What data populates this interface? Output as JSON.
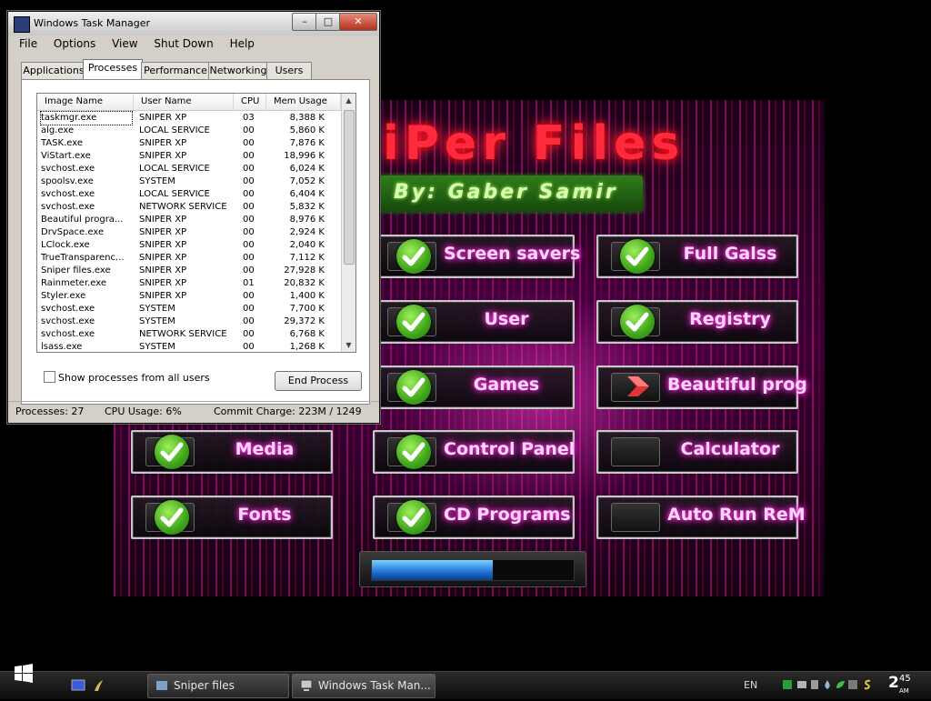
{
  "app": {
    "title": "iPer  Files",
    "byline": "By: Gaber  Samir",
    "buttons": [
      {
        "label": "Screen savers",
        "kind": "check"
      },
      {
        "label": "Full Galss",
        "kind": "check"
      },
      {
        "label": "User",
        "kind": "check"
      },
      {
        "label": "Registry",
        "kind": "check"
      },
      {
        "label": "Games",
        "kind": "check"
      },
      {
        "label": "Beautiful prog",
        "kind": "arrow"
      },
      {
        "label": "Media",
        "kind": "check"
      },
      {
        "label": "Control Panel",
        "kind": "check"
      },
      {
        "label": "Calculator",
        "kind": "empty"
      },
      {
        "label": "Fonts",
        "kind": "check"
      },
      {
        "label": "CD Programs",
        "kind": "check"
      },
      {
        "label": "Auto Run ReM",
        "kind": "empty"
      }
    ],
    "progress": 0.6,
    "colors": {
      "title": "#ff2a3c",
      "button_text": "#ffd6ff",
      "byline_bg": "#2f7d1a",
      "check": "#3fa51a"
    }
  },
  "task_manager": {
    "title": "Windows Task Manager",
    "menu": [
      "File",
      "Options",
      "View",
      "Shut Down",
      "Help"
    ],
    "tabs": [
      "Applications",
      "Processes",
      "Performance",
      "Networking",
      "Users"
    ],
    "active_tab": "Processes",
    "columns": [
      "Image Name",
      "User Name",
      "CPU",
      "Mem Usage"
    ],
    "processes": [
      [
        "taskmgr.exe",
        "SNIPER XP",
        "03",
        "8,388 K"
      ],
      [
        "alg.exe",
        "LOCAL SERVICE",
        "00",
        "5,860 K"
      ],
      [
        "TASK.exe",
        "SNIPER XP",
        "00",
        "7,876 K"
      ],
      [
        "ViStart.exe",
        "SNIPER XP",
        "00",
        "18,996 K"
      ],
      [
        "svchost.exe",
        "LOCAL SERVICE",
        "00",
        "6,024 K"
      ],
      [
        "spoolsv.exe",
        "SYSTEM",
        "00",
        "7,052 K"
      ],
      [
        "svchost.exe",
        "LOCAL SERVICE",
        "00",
        "6,404 K"
      ],
      [
        "svchost.exe",
        "NETWORK SERVICE",
        "00",
        "5,832 K"
      ],
      [
        "Beautiful progra...",
        "SNIPER XP",
        "00",
        "8,976 K"
      ],
      [
        "DrvSpace.exe",
        "SNIPER XP",
        "00",
        "2,924 K"
      ],
      [
        "LClock.exe",
        "SNIPER XP",
        "00",
        "2,040 K"
      ],
      [
        "TrueTransparenc...",
        "SNIPER XP",
        "00",
        "7,112 K"
      ],
      [
        "Sniper files.exe",
        "SNIPER XP",
        "00",
        "27,928 K"
      ],
      [
        "Rainmeter.exe",
        "SNIPER XP",
        "01",
        "20,832 K"
      ],
      [
        "Styler.exe",
        "SNIPER XP",
        "00",
        "1,400 K"
      ],
      [
        "svchost.exe",
        "SYSTEM",
        "00",
        "7,700 K"
      ],
      [
        "svchost.exe",
        "SYSTEM",
        "00",
        "29,372 K"
      ],
      [
        "svchost.exe",
        "NETWORK SERVICE",
        "00",
        "6,768 K"
      ],
      [
        "lsass.exe",
        "SYSTEM",
        "00",
        "1,268 K"
      ]
    ],
    "show_all_label": "Show processes from all users",
    "end_process_label": "End Process",
    "status": {
      "processes": "Processes: 27",
      "cpu": "CPU Usage: 6%",
      "commit": "Commit Charge: 223M / 1249"
    }
  },
  "taskbar": {
    "items": [
      {
        "label": "Sniper files"
      },
      {
        "label": "Windows Task Man..."
      }
    ],
    "lang": "EN",
    "clock_time": "2",
    "clock_minutes": "45",
    "clock_ampm": "AM"
  }
}
